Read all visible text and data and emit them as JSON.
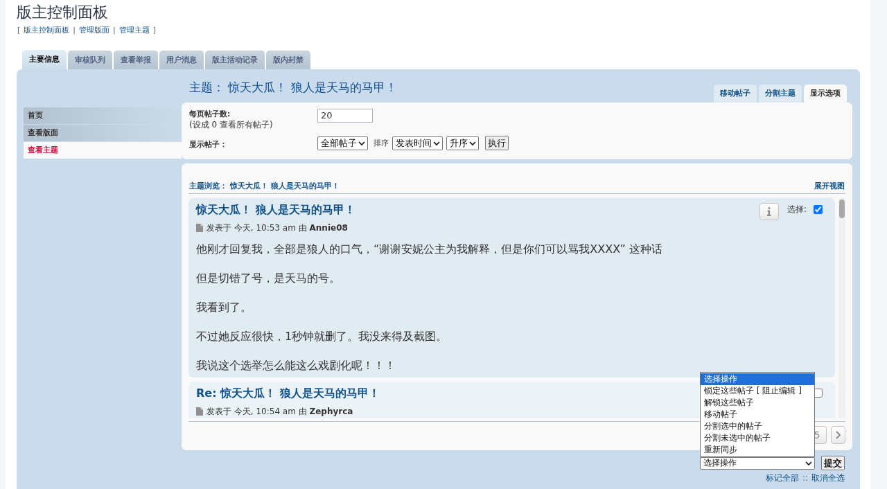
{
  "page_title": "版主控制面板",
  "breadcrumb": [
    {
      "kind": "punct",
      "text": "["
    },
    {
      "kind": "link",
      "text": "版主控制面板"
    },
    {
      "kind": "punct",
      "text": "|"
    },
    {
      "kind": "link",
      "text": "管理版面"
    },
    {
      "kind": "punct",
      "text": "|"
    },
    {
      "kind": "link",
      "text": "管理主题"
    },
    {
      "kind": "punct",
      "text": "]"
    }
  ],
  "tabs": [
    {
      "label": "主要信息",
      "selected": true
    },
    {
      "label": "审核队列",
      "selected": false
    },
    {
      "label": "查看举报",
      "selected": false
    },
    {
      "label": "用户消息",
      "selected": false
    },
    {
      "label": "版主活动记录",
      "selected": false
    },
    {
      "label": "版内封禁",
      "selected": false
    }
  ],
  "sidebar": {
    "items": [
      {
        "label": "首页",
        "selected": false
      },
      {
        "label": "查看版面",
        "selected": false
      },
      {
        "label": "查看主题",
        "selected": true
      }
    ]
  },
  "topic_heading": "主题： 惊天大瓜！ 狼人是天马的马甲！",
  "subtabs": [
    {
      "label": "移动帖子",
      "selected": false
    },
    {
      "label": "分割主题",
      "selected": false
    },
    {
      "label": "显示选项",
      "selected": true
    }
  ],
  "display_options": {
    "per_page": {
      "label": "每页帖子数:",
      "hint": "(设成 0 查看所有帖子)",
      "value": "20"
    },
    "show_posts": {
      "label": "显示帖子：",
      "filter": "全部帖子",
      "sort_label": "排序",
      "sort_key": "发表时间",
      "sort_order": "升序",
      "go_button": "执行"
    }
  },
  "topic_view": {
    "heading": "主题浏览： 惊天大瓜！ 狼人是天马的马甲！",
    "expand_link": "展开视图",
    "posts": [
      {
        "title": "惊天大瓜！ 狼人是天马的马甲！",
        "meta": "发表于 今天, 10:53 am 由 **Annie08**",
        "select_label": "选择:",
        "checked": true,
        "paragraphs": [
          "他刚才回复我，全部是狼人的口气，“谢谢安妮公主为我解释，但是你们可以骂我XXXX” 这种话",
          "但是切错了号，是天马的号。",
          "我看到了。",
          "不过她反应很快，1秒钟就删了。我没来得及截图。",
          "我说这个选举怎么能这么戏剧化呢！！！"
        ]
      },
      {
        "title": "Re: 惊天大瓜！ 狼人是天马的马甲！",
        "meta": "发表于 今天, 10:54 am 由 **Zephyrca**",
        "checked": false
      }
    ]
  },
  "pagination": {
    "pages": [
      "5"
    ]
  },
  "moderation": {
    "action_select": "选择操作",
    "options": [
      {
        "label": "选择操作",
        "selected": true
      },
      {
        "label": "锁定这些帖子 [ 阻止编辑 ]",
        "selected": false
      },
      {
        "label": "解锁这些帖子",
        "selected": false
      },
      {
        "label": "移动帖子",
        "selected": false
      },
      {
        "label": "分割选中的帖子",
        "selected": false
      },
      {
        "label": "分割未选中的帖子",
        "selected": false
      },
      {
        "label": "重新同步",
        "selected": false
      }
    ],
    "submit_button": "提交",
    "links": [
      {
        "kind": "link",
        "text": "标记全部"
      },
      {
        "kind": "punct",
        "text": "::"
      },
      {
        "kind": "link",
        "text": "取消全选"
      }
    ]
  }
}
